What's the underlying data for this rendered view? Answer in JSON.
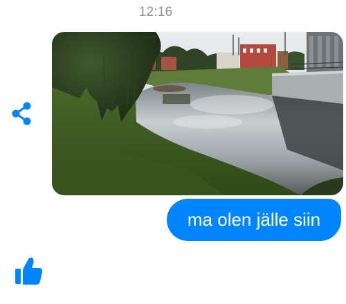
{
  "thread": {
    "timestamp": "12:16",
    "messages": [
      {
        "type": "photo",
        "description": ""
      },
      {
        "type": "text",
        "text": "ma olen jälle siin"
      }
    ]
  },
  "icons": {
    "share": "share-icon",
    "like": "thumbs-up-icon"
  },
  "colors": {
    "accent": "#0084ff",
    "timestamp": "#8e8e93",
    "background": "#ffffff"
  }
}
